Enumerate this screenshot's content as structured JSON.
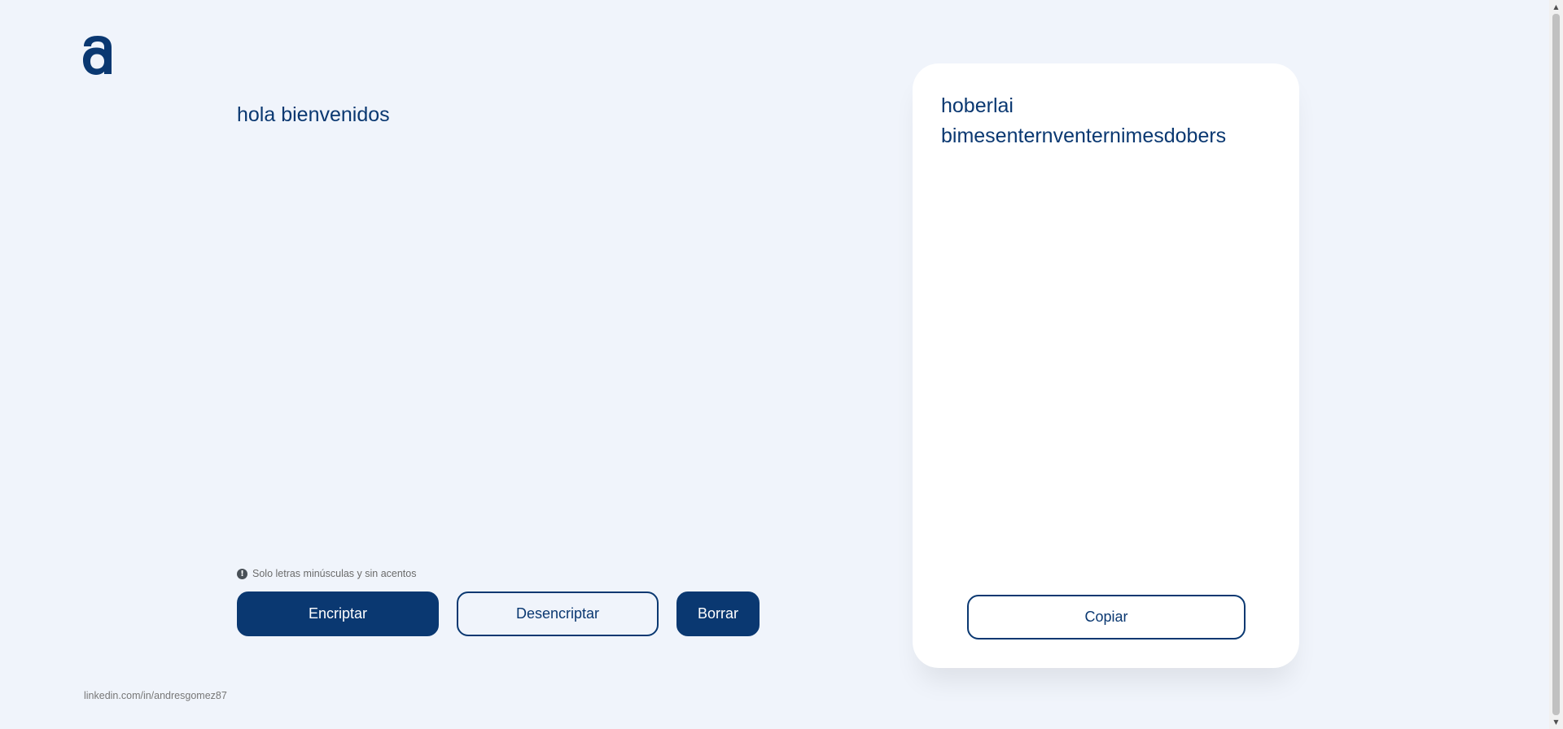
{
  "brand": {
    "logo_letter": "a",
    "logo_icon": "alura-a-logo-icon",
    "color": "#0a3871"
  },
  "input": {
    "value": "hola bienvenidos",
    "placeholder": ""
  },
  "hint": {
    "icon": "info-circle-icon",
    "text": "Solo letras minúsculas y sin acentos"
  },
  "buttons": {
    "encrypt_label": "Encriptar",
    "decrypt_label": "Desencriptar",
    "clear_label": "Borrar",
    "copy_label": "Copiar"
  },
  "output": {
    "text": "hoberlai bimesenternventernimesdobers"
  },
  "footer": {
    "link_text": "linkedin.com/in/andresgomez87"
  },
  "colors": {
    "background": "#f0f4fb",
    "primary": "#0a3871",
    "card": "#ffffff"
  }
}
